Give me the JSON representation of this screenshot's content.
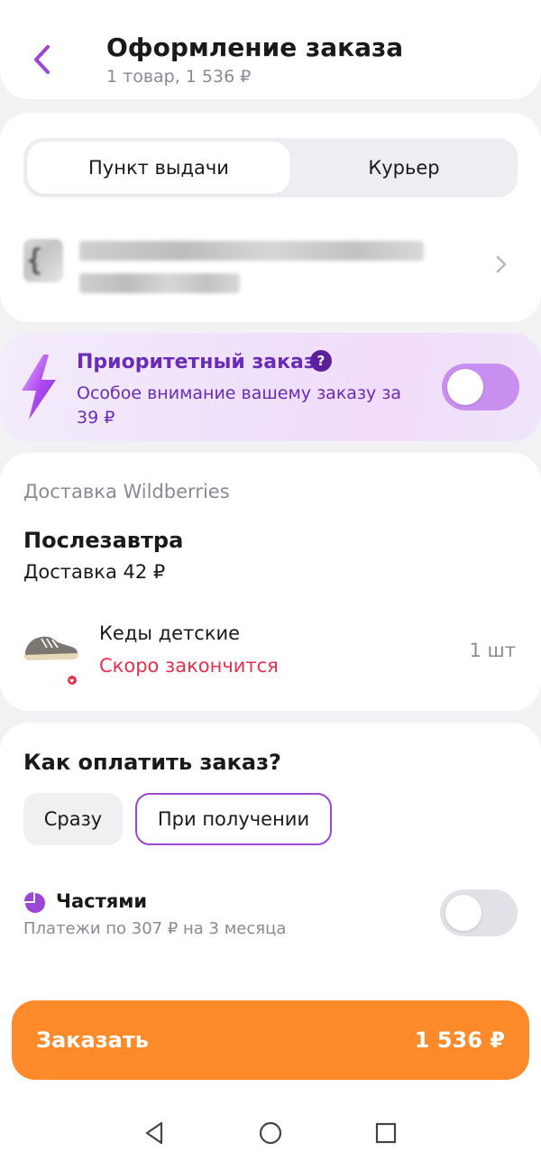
{
  "header": {
    "title": "Оформление заказа",
    "subtitle": "1 товар, 1 536 ₽"
  },
  "delivery_type": {
    "tabs": [
      {
        "label": "Пункт выдачи",
        "selected": true
      },
      {
        "label": "Курьер",
        "selected": false
      }
    ]
  },
  "priority": {
    "title": "Приоритетный заказ",
    "help_symbol": "?",
    "description": "Особое внимание вашему заказу за 39 ₽",
    "enabled": false
  },
  "shipping": {
    "label": "Доставка Wildberries",
    "when": "Послезавтра",
    "cost": "Доставка 42 ₽",
    "product": {
      "name": "Кеды детские",
      "warning": "Скоро закончится",
      "quantity": "1 шт"
    }
  },
  "payment": {
    "title": "Как оплатить заказ?",
    "options": [
      {
        "label": "Сразу",
        "selected": false
      },
      {
        "label": "При получении",
        "selected": true
      }
    ],
    "installments": {
      "title": "Частями",
      "subtitle": "Платежи по 307 ₽ на 3 месяца",
      "enabled": false
    }
  },
  "order": {
    "label": "Заказать",
    "price": "1 536 ₽"
  },
  "colors": {
    "accent": "#9c46d6",
    "order_button": "#ff8a2a",
    "warning": "#e8304a",
    "priority_text": "#6a2bb8"
  }
}
